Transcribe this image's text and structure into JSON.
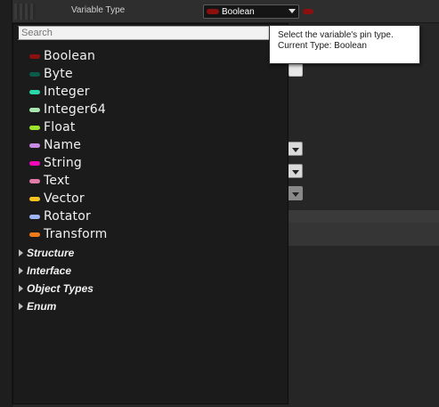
{
  "property": {
    "label": "Variable Type",
    "current_type": "Boolean",
    "current_color": "#8b1010"
  },
  "search": {
    "placeholder": "Search"
  },
  "types": [
    {
      "label": "Boolean",
      "color": "#8b1010"
    },
    {
      "label": "Byte",
      "color": "#0a5a4a"
    },
    {
      "label": "Integer",
      "color": "#2ad7a8"
    },
    {
      "label": "Integer64",
      "color": "#a8e6b0"
    },
    {
      "label": "Float",
      "color": "#9ee32c"
    },
    {
      "label": "Name",
      "color": "#c78ae6"
    },
    {
      "label": "String",
      "color": "#f00ab8"
    },
    {
      "label": "Text",
      "color": "#e27ba8"
    },
    {
      "label": "Vector",
      "color": "#f5c221"
    },
    {
      "label": "Rotator",
      "color": "#9eb4f5"
    },
    {
      "label": "Transform",
      "color": "#f07a1a"
    }
  ],
  "categories": [
    {
      "label": "Structure"
    },
    {
      "label": "Interface"
    },
    {
      "label": "Object Types"
    },
    {
      "label": "Enum"
    }
  ],
  "tooltip": {
    "line1": "Select the variable's pin type.",
    "line2": "Current Type: Boolean"
  }
}
